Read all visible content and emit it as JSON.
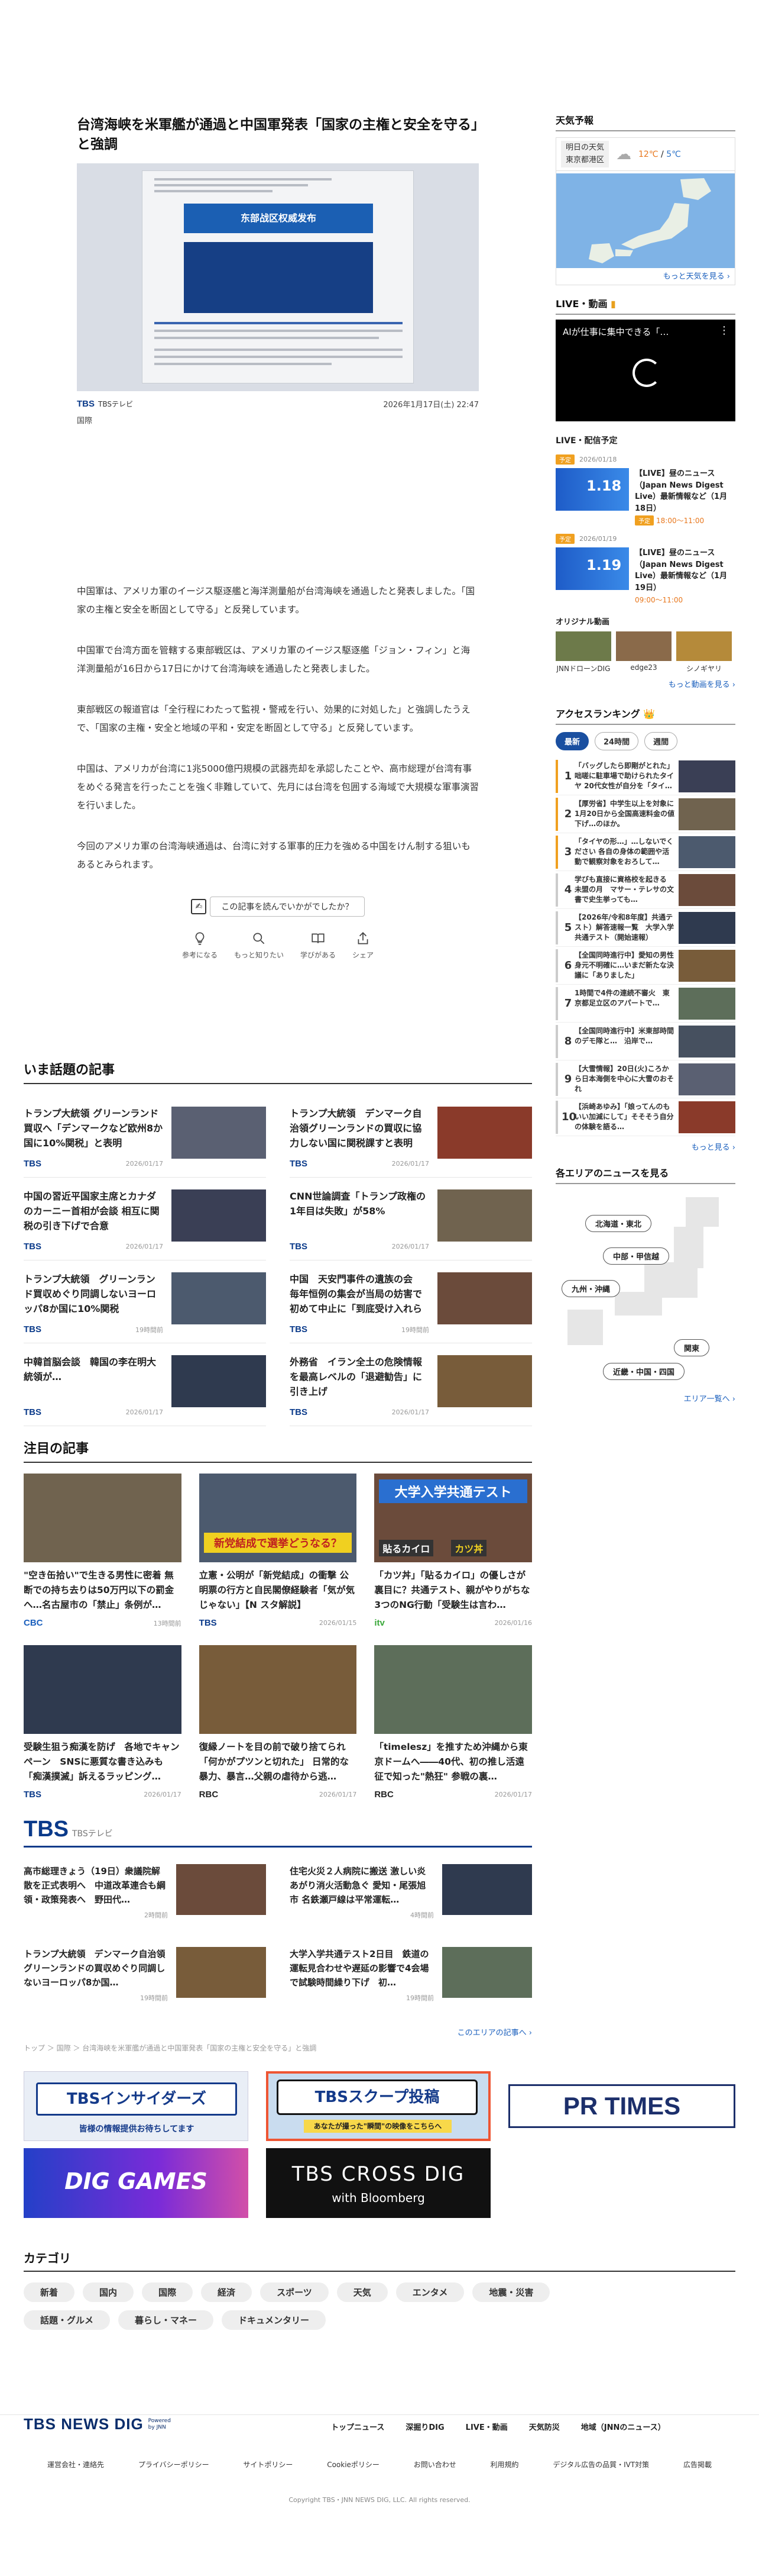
{
  "article": {
    "title": "台湾海峡を米軍艦が通過と中国軍発表「国家の主権と安全を守る」と強調",
    "source": "TBS",
    "source_name": "TBSテレビ",
    "date": "2026年1月17日(土) 22:47",
    "category": "国際",
    "hero_heading": "东部战区权威发布",
    "paragraphs": [
      "中国軍は、アメリカ軍のイージス駆逐艦と海洋測量船が台湾海峡を通過したと発表しました。「国家の主権と安全を断固として守る」と反発しています。",
      "中国軍で台湾方面を管轄する東部戦区は、アメリカ軍のイージス駆逐艦「ジョン・フィン」と海洋測量船が16日から17日にかけて台湾海峡を通過したと発表しました。",
      "東部戦区の報道官は「全行程にわたって監視・警戒を行い、効果的に対処した」と強調したうえで、「国家の主権・安全と地域の平和・安定を断固として守る」と反発しています。",
      "中国は、アメリカが台湾に1兆5000億円規模の武器売却を承認したことや、高市総理が台湾有事をめぐる発言を行ったことを強く非難していて、先月には台湾を包囲する海域で大規模な軍事演習を行いました。",
      "今回のアメリカ軍の台湾海峡通過は、台湾に対する軍事的圧力を強める中国をけん制する狙いもあるとみられます。"
    ],
    "survey_label": "この記事を読んでいかがでしたか？",
    "reactions": [
      "参考になる",
      "もっと知りたい",
      "学びがある",
      "シェア"
    ]
  },
  "trending": {
    "title": "いま話題の記事",
    "items": [
      {
        "title": "トランプ大統領 グリーンランド買収へ「デンマークなど欧州8か国に10%関税」と表明",
        "src": "TBS",
        "date": "2026/01/17"
      },
      {
        "title": "トランプ大統領　デンマーク自治領グリーンランドの買収に協力しない国に関税課すと表明",
        "src": "TBS",
        "date": "2026/01/17"
      },
      {
        "title": "中国の習近平国家主席とカナダのカーニー首相が会談 相互に関税の引き下げで合意",
        "src": "TBS",
        "date": "2026/01/17"
      },
      {
        "title": "CNN世論調査「トランプ政権の1年目は失敗」が58%",
        "src": "TBS",
        "date": "2026/01/17"
      },
      {
        "title": "トランプ大統領　グリーンランド買収めぐり同調しないヨーロッパ8か国に10%関税",
        "src": "TBS",
        "date": "19時間前"
      },
      {
        "title": "中国　天安門事件の遺族の会　毎年恒例の集会が当局の妨害で初めて中止に「到底受け入れられない」",
        "src": "TBS",
        "date": "19時間前"
      },
      {
        "title": "中韓首脳会談　韓国の李在明大統領が…",
        "src": "TBS",
        "date": "2026/01/17"
      },
      {
        "title": "外務省　イラン全土の危険情報を最高レベルの「退避勧告」に引き上げ",
        "src": "TBS",
        "date": "2026/01/17"
      }
    ]
  },
  "featured": {
    "title": "注目の記事",
    "items": [
      {
        "title": "\"空き缶拾い\"で生きる男性に密着 無断での持ち去りは50万円以下の罰金へ…名古屋市の「禁止」条例が…",
        "src": "CBC",
        "date": "13時間前"
      },
      {
        "title": "立憲・公明が「新党結成」の衝撃 公明票の行方と自民閣僚経験者「気が気じゃない」【N スタ解説】",
        "src": "TBS",
        "date": "2026/01/15"
      },
      {
        "title": "「カツ丼」「貼るカイロ」の優しさが裏目に？共通テスト、親がやりがちな3つのNG行動「受験生は言わ…",
        "src": "itv",
        "date": "2026/01/16"
      },
      {
        "title": "受験生狙う痴漢を防げ　各地でキャンペーン　SNSに悪質な書き込みも「痴漢撲滅」訴えるラッピング…",
        "src": "TBS",
        "date": "2026/01/17"
      },
      {
        "title": "復縁ノートを目の前で破り捨てられ「何かがプツンと切れた」 日常的な暴力、暴言…父親の虐待から逃…",
        "src": "RBC",
        "date": "2026/01/17"
      },
      {
        "title": "「timelesz」を推すため沖縄から東京ドームへ――40代、初の推し活遠征で知った\"熱狂\" 参戦の裏…",
        "src": "RBC",
        "date": "2026/01/17"
      }
    ],
    "thumb_captions": [
      "新党結成で選挙どうなる？",
      "大学入学共通テスト",
      "貼るカイロ",
      "カツ丼"
    ]
  },
  "tbs_block": {
    "logo": "TBS",
    "logo_sub": "TBSテレビ",
    "items": [
      {
        "title": "高市総理きょう（19日）衆議院解散を正式表明へ　中道改革連合も綱領・政策発表へ　野田代…",
        "date": "2時間前"
      },
      {
        "title": "住宅火災２人病院に搬送 激しい炎あがり消火活動急ぐ 愛知・尾張旭市 名鉄瀬戸線は平常運転…",
        "date": "4時間前"
      },
      {
        "title": "トランプ大統領　デンマーク自治領グリーンランドの買収めぐり同調しないヨーロッパ8か国…",
        "date": "19時間前"
      },
      {
        "title": "大学入学共通テスト2日目　鉄道の運転見合わせや遅延の影響で4会場で試験時間繰り下げ　初…",
        "date": "19時間前"
      }
    ],
    "more": "このエリアの記事へ"
  },
  "breadcrumb": "トップ ＞ 国際 ＞ 台湾海峡を米軍艦が通過と中国軍発表「国家の主権と安全を守る」と強調",
  "banners": {
    "insider": "TBSインサイダーズ",
    "insider_sub": "皆様の情報提供お待ちしてます",
    "scoop": "TBSスクープ投稿",
    "scoop_sub": "あなたが撮った\"瞬間\"の映像をこちらへ",
    "prtimes": "PR TIMES",
    "games": "DIG GAMES",
    "crossdig": "TBS CROSS DIG",
    "crossdig_sub": "with Bloomberg"
  },
  "categories": {
    "title": "カテゴリ",
    "items": [
      "新着",
      "国内",
      "国際",
      "経済",
      "スポーツ",
      "天気",
      "エンタメ",
      "地震・災害",
      "話題・グルメ",
      "暮らし・マネー",
      "ドキュメンタリー"
    ]
  },
  "footer": {
    "logo": "TBS NEWS DIG",
    "logo_sub": "Powered by JNN",
    "nav": [
      "トップニュース",
      "深掘りDIG",
      "LIVE・動画",
      "天気防災",
      "地域（JNNのニュース）"
    ],
    "links": [
      "運営会社・連絡先",
      "プライバシーポリシー",
      "サイトポリシー",
      "Cookieポリシー",
      "お問い合わせ",
      "利用規約",
      "デジタル広告の品質・IVT対策",
      "広告掲載"
    ],
    "copyright": "Copyright TBS・JNN NEWS DIG, LLC. All rights reserved."
  },
  "sidebar": {
    "weather": {
      "title": "天気予報",
      "label1": "明日の天気",
      "label2": "東京都港区",
      "high": "12℃",
      "low": "5℃",
      "more": "もっと天気を見る"
    },
    "live": {
      "title": "LIVE・動画",
      "video_title": "AIが仕事に集中できる「…",
      "schedule_title": "LIVE・配信予定",
      "items": [
        {
          "badge": "予定",
          "date": "2026/01/18",
          "title": "【LIVE】昼のニュース（Japan News Digest Live）最新情報など（1月18日）",
          "time_label": "予定",
          "time": "18:00～11:00",
          "thumb_date": "1.18"
        },
        {
          "badge": "予定",
          "date": "2026/01/19",
          "title": "【LIVE】昼のニュース（Japan News Digest Live）最新情報など（1月19日）",
          "time_label": "",
          "time": "09:00～11:00",
          "thumb_date": "1.19"
        }
      ],
      "orig_title": "オリジナル動画",
      "orig": [
        "JNNドローンDIG",
        "edge23",
        "シノギヤリ"
      ],
      "more": "もっと動画を見る"
    },
    "ranking": {
      "title": "アクセスランキング",
      "tabs": [
        "最新",
        "24時間",
        "週間"
      ],
      "items": [
        "「バッグしたら即剛がとれた」　咄嗟に駐車場で助けられたタイヤ 20代女性が自分を「タイ…",
        "【厚労省】中学生以上を対象に1月20日から全国高速料金の値下げ…のほか。",
        "「タイヤの形…」…しないでください 各自の身体の範囲や活動で観察対象をおろして…",
        "学びも直接に資格校を起きる 未盟の月　マサー・テレサの文書で史生挙っても…",
        "【2026年/令和8年度】共通テスト）解答速報一覧　大学入学共通テスト（開始速報）",
        "【全国同時進行中】愛知の男性 身元不明確に…いまだ新たな決議に「ありました」",
        "1時間で4件の連続不審火　東京都足立区のアパートで…",
        "【全国同時進行中】米東部時間のデモ隊と…　沿岸で…",
        "【大雪情報】20日(火)ころから日本海側を中心に大雪のおそれ",
        "【浜崎あゆみ】「娘ってんのもいい加減にして」そそそう自分の体験を語る…"
      ],
      "more": "もっと見る"
    },
    "area": {
      "title": "各エリアのニュースを見る",
      "regions": [
        "北海道・東北",
        "中部・甲信越",
        "九州・沖縄",
        "関東",
        "近畿・中国・四国"
      ],
      "more": "エリア一覧へ"
    }
  },
  "colors": {
    "brand": "#0a3a8a",
    "accent_orange": "#f0a020",
    "link": "#1a5fbd"
  }
}
